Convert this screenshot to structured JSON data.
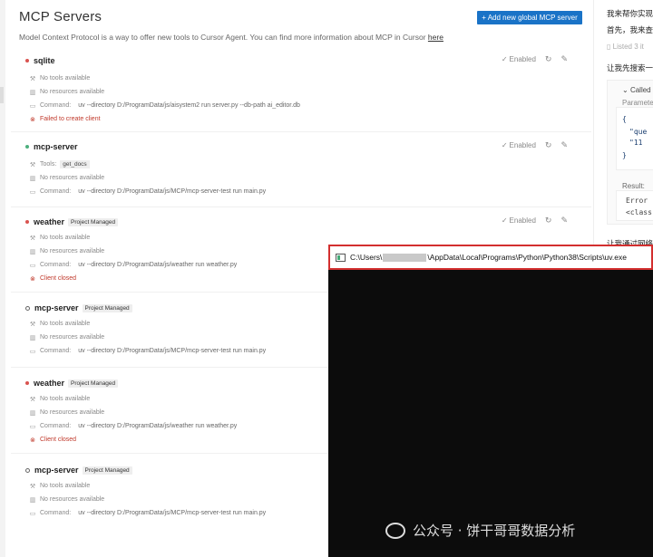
{
  "header": {
    "title": "MCP Servers",
    "add_button": "+ Add new global MCP server",
    "description": "Model Context Protocol is a way to offer new tools to Cursor Agent. You can find more information about MCP in Cursor",
    "description_link": "here"
  },
  "status_colors": {
    "error": "#d9534f",
    "ok": "#4caf7d",
    "idle": "#666666",
    "accent": "#1a73c7"
  },
  "servers": [
    {
      "name": "sqlite",
      "badge": "",
      "enabled_label": "Enabled",
      "status": "error",
      "tools": "No tools available",
      "resources": "No resources available",
      "command_label": "Command:",
      "command": "uv --directory D:/ProgramData/js/aisystem2 run server.py --db-path ai_editor.db",
      "error": "Failed to create client"
    },
    {
      "name": "mcp-server",
      "badge": "",
      "enabled_label": "Enabled",
      "status": "ok",
      "tools_label": "Tools:",
      "tools_chip": "get_docs",
      "resources": "No resources available",
      "command_label": "Command:",
      "command": "uv --directory D:/ProgramData/js/MCP/mcp-server-test run main.py"
    },
    {
      "name": "weather",
      "badge": "Project Managed",
      "enabled_label": "Enabled",
      "status": "error",
      "tools": "No tools available",
      "resources": "No resources available",
      "command_label": "Command:",
      "command": "uv --directory D:/ProgramData/js/weather run weather.py",
      "error": "Client closed"
    },
    {
      "name": "mcp-server",
      "badge": "Project Managed",
      "status": "idle",
      "tools": "No tools available",
      "resources": "No resources available",
      "command_label": "Command:",
      "command": "uv --directory D:/ProgramData/js/MCP/mcp-server-test run main.py"
    },
    {
      "name": "weather",
      "badge": "Project Managed",
      "status": "error",
      "tools": "No tools available",
      "resources": "No resources available",
      "command_label": "Command:",
      "command": "uv --directory D:/ProgramData/js/weather run weather.py",
      "error": "Client closed"
    },
    {
      "name": "mcp-server",
      "badge": "Project Managed",
      "status": "idle",
      "tools": "No tools available",
      "resources": "No resources available",
      "command_label": "Command:",
      "command": "uv --directory D:/ProgramData/js/MCP/mcp-server-test run main.py"
    }
  ],
  "chat": {
    "line1": "我来帮你实现",
    "line2": "首先，我来查",
    "listed": "Listed 3 it",
    "line3": "让我先搜索一",
    "called": "Called MC",
    "params": "Paramete",
    "code1": "{",
    "code2": "\"que",
    "code3": "\"11",
    "code4": "}",
    "result": "Result:",
    "err1": "Error -",
    "err2": "<class",
    "line4": "让我通过网络"
  },
  "terminal": {
    "path_prefix": "C:\\Users\\",
    "path_suffix": "\\AppData\\Local\\Programs\\Python\\Python38\\Scripts\\uv.exe"
  },
  "watermark": "公众号 · 饼干哥哥数据分析"
}
